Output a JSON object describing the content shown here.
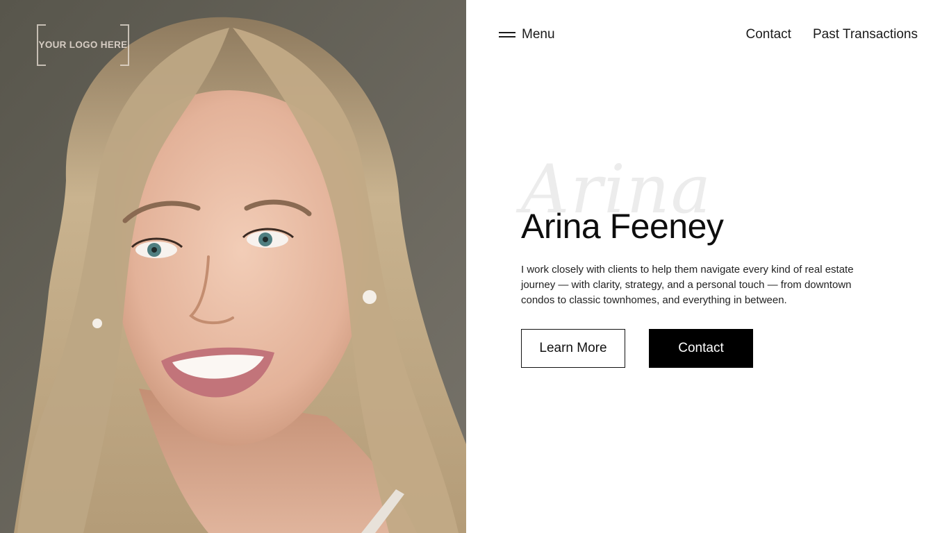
{
  "logo": {
    "text": "YOUR LOGO HERE"
  },
  "nav": {
    "menu_label": "Menu",
    "menu_icon": "hamburger-icon",
    "links": [
      {
        "label": "Contact"
      },
      {
        "label": "Past Transactions"
      }
    ]
  },
  "hero": {
    "script_name": "Arina",
    "name": "Arina Feeney",
    "bio": "I work closely with clients to help them navigate every kind of real estate journey — with clarity, strategy, and a personal touch — from downtown condos to classic townhomes, and everything in between.",
    "primary_button": "Learn More",
    "secondary_button": "Contact"
  },
  "colors": {
    "photo_background": "#6a675d",
    "text": "#111111",
    "button_solid": "#000000",
    "script_watermark": "#ececec"
  }
}
